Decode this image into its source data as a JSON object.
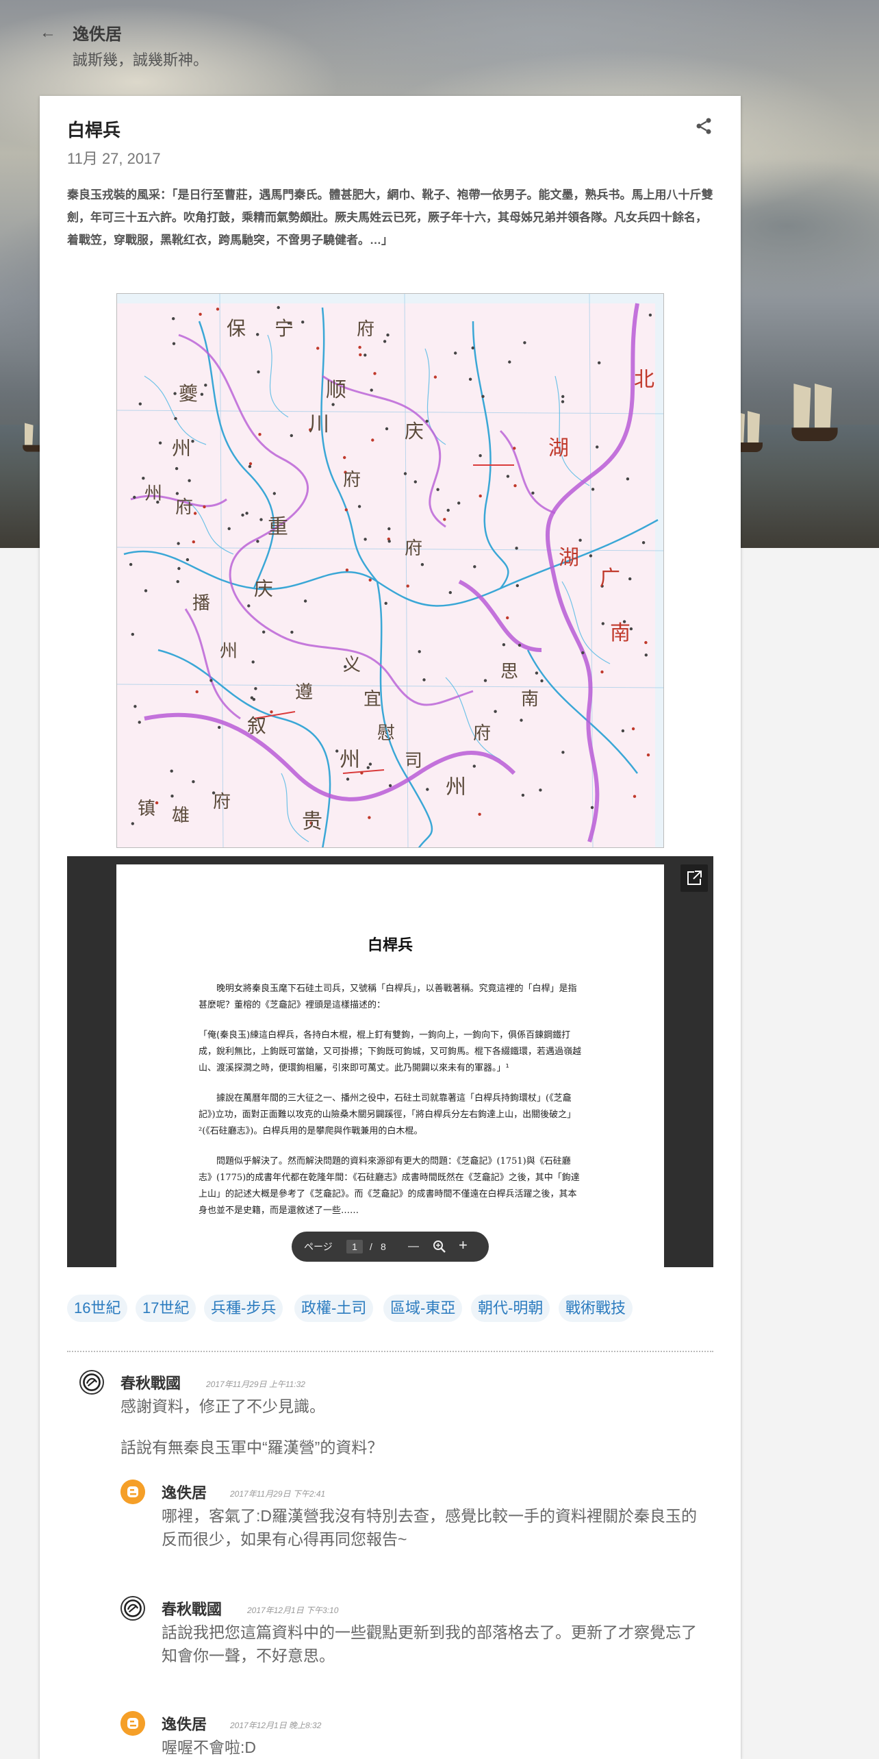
{
  "header": {
    "blog_title": "逸佚居",
    "blog_description": "誠斯幾，誠幾斯神。"
  },
  "post": {
    "title": "白桿兵",
    "date": "11月 27, 2017",
    "snippet": "秦良玉戎裝的風采：「是日行至曹莊，遇馬門秦氏。體甚肥大，網巾、靴子、袍帶一依男子。能文墨，熟兵书。馬上用八十斤雙劍，年可三十五六許。吹角打鼓，乘精而氣勢頗壯。厥夫馬姓云已死，厥子年十六，其母姊兄弟并領各隊。凡女兵四十餘名，着戰笠，穿戰服，黑靴红衣，跨馬馳突，不啻男子驍健者。…」"
  },
  "map": {
    "region_labels": [
      "北",
      "湖",
      "湖",
      "南",
      "广",
      "川",
      "府",
      "贵",
      "州",
      "州",
      "保",
      "宁",
      "府",
      "顺",
      "庆",
      "府",
      "夔",
      "州",
      "重",
      "庆",
      "叙",
      "州",
      "府",
      "播",
      "州",
      "遵",
      "义",
      "宜",
      "慰",
      "司",
      "思",
      "南",
      "府",
      "镇",
      "雄",
      "府"
    ]
  },
  "viewer": {
    "doc_title": "白桿兵",
    "paragraphs": [
      "晚明女將秦良玉麾下石硅土司兵，又號稱「白桿兵」，以善戰著稱。究竟這裡的「白桿」是指甚麼呢？董榕的《芝龕記》裡頭是這樣描述的：",
      "「俺(秦良玉)練這白桿兵，各持白木棍，棍上釘有雙鉤，一鉤向上，一鉤向下，俱係百錬鋼鐵打成，銳利無比，上鉤既可當鎗，又可掛攃；下鉤既可鉤城，又可鉤馬。棍下各綴鐵環，若遇過嶺越山、渡溪探澗之時，便環鉤相屬，引來即可萬丈。此乃開闢以來未有的軍器。」¹",
      "據說在萬曆年間的三大征之一、播州之役中，石砫土司就靠著這「白桿兵持鉤環杖」(《芝龕記》)立功，面對正面難以攻克的山險桑木關另闢蹊徑，「將白桿兵分左右鉤達上山，出關後破之」²(《石砫廳志》)。白桿兵用的是攀爬與作戰兼用的白木棍。",
      "問題似乎解決了。然而解決問題的資料來源卻有更大的問題：《芝龕記》(1751)與《石砫廳志》(1775)的成書年代都在乾隆年間：《石砫廳志》成書時間既然在《芝龕記》之後，其中「鉤達上山」的記述大概是參考了《芝龕記》。而《芝龕記》的成書時間不僅遠在白桿兵活躍之後，其本身也並不是史籍，而是還敘述了一些……"
    ],
    "toolbar": {
      "page_label": "ページ",
      "current_page": "1",
      "separator": "/",
      "total_pages": "8",
      "zoom_out": "—",
      "zoom_in": "+"
    }
  },
  "labels": [
    "16世紀",
    "17世紀",
    "兵種-步兵",
    "政權-土司",
    "區域-東亞",
    "朝代-明朝",
    "戰術戰技"
  ],
  "comments": [
    {
      "author": "春秋戰國",
      "time": "2017年11月29日 上午11:32",
      "lines": [
        "感謝資料，修正了不少見識。",
        "話說有無秦良玉軍中“羅漢營”的資料？"
      ]
    },
    {
      "author": "逸佚居",
      "time": "2017年11月29日 下午2:41",
      "lines": [
        "哪裡，客氣了:D羅漢營我沒有特別去查，感覺比較一手的資料裡關於秦良玉的反而很少，如果有心得再同您報告~"
      ]
    },
    {
      "author": "春秋戰國",
      "time": "2017年12月1日 下午3:10",
      "lines": [
        "話說我把您這篇資料中的一些觀點更新到我的部落格去了。更新了才察覺忘了知會你一聲，不好意思。"
      ]
    },
    {
      "author": "逸佚居",
      "time": "2017年12月1日 晚上8:32",
      "lines": [
        "喔喔不會啦:D"
      ]
    }
  ],
  "colors": {
    "label_text": "#2b7bbf",
    "label_bg": "#eef4f9",
    "blogger_avatar": "#f59f28",
    "map_boundary": "#b85cd6",
    "map_river": "#3aa7d6"
  },
  "icons": [
    "back-arrow-icon",
    "share-icon",
    "open-in-new-icon",
    "zoom-icon",
    "blogger-icon",
    "ink-seal-avatar-icon"
  ]
}
